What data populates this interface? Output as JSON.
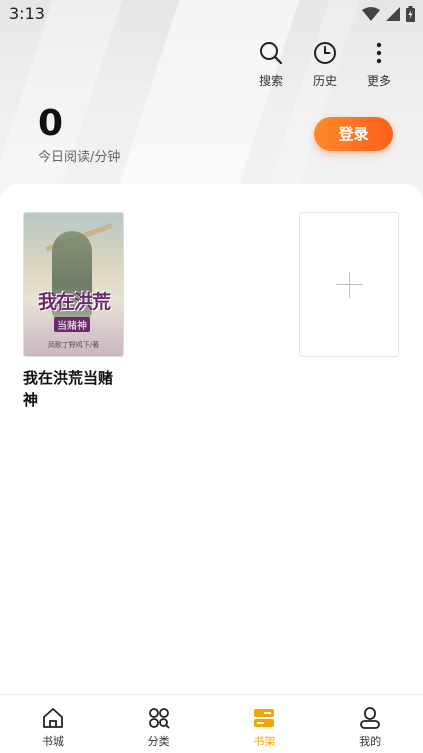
{
  "status_bar": {
    "time": "3:13"
  },
  "top_actions": [
    {
      "label": "搜索",
      "icon": "search-icon"
    },
    {
      "label": "历史",
      "icon": "history-icon"
    },
    {
      "label": "更多",
      "icon": "more-icon"
    }
  ],
  "reading": {
    "minutes": "0",
    "caption": "今日阅读/分钟"
  },
  "login_button": "登录",
  "books": [
    {
      "title": "我在洪荒当赌神",
      "cover_title": "我在洪荒",
      "cover_subtitle": "当赌神",
      "cover_author": "凤歌丁野鸡下/著"
    }
  ],
  "bottom_nav": [
    {
      "label": "书城",
      "icon": "home-icon"
    },
    {
      "label": "分类",
      "icon": "category-icon"
    },
    {
      "label": "书架",
      "icon": "bookshelf-icon",
      "active": true
    },
    {
      "label": "我的",
      "icon": "profile-icon"
    }
  ],
  "colors": {
    "accent": "#f5a500",
    "login_start": "#ff8a2a",
    "login_end": "#ff5f1a"
  }
}
